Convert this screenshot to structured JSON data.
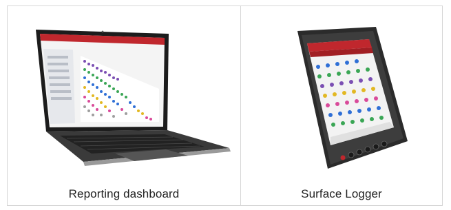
{
  "tiles": [
    {
      "caption": "Reporting dashboard",
      "image": "laptop-with-dashboard",
      "accent": "#c0272d"
    },
    {
      "caption": "Surface Logger",
      "image": "rugged-tablet",
      "accent": "#c0272d"
    }
  ]
}
